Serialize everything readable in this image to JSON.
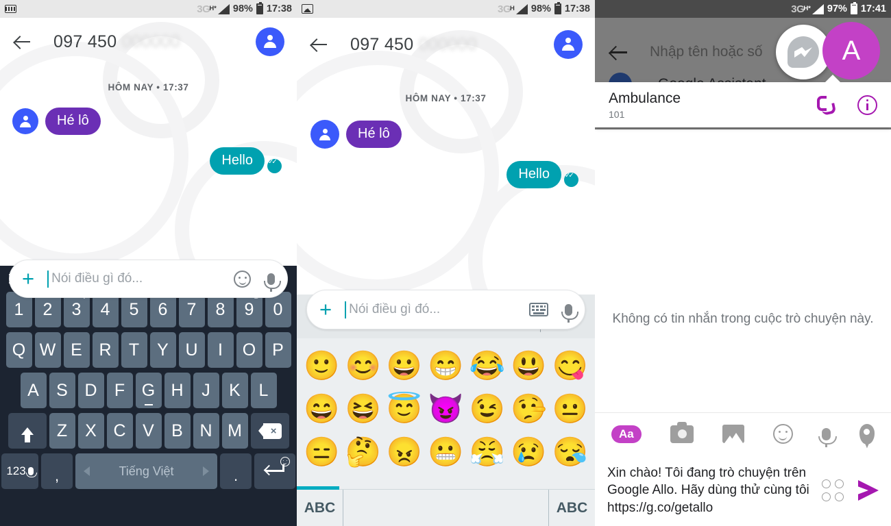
{
  "panels": {
    "left": {
      "status": {
        "icon": "keyboard-icon",
        "network": "3G",
        "network_sub": "H*",
        "battery": "98%",
        "time": "17:38"
      },
      "header": {
        "title": "097 450",
        "title_blurred": "000000",
        "back": "back-arrow",
        "avatar": "contact-avatar"
      },
      "chat": {
        "daystamp": "HÔM NAY • 17:37",
        "messages": [
          {
            "text": "Hé lô",
            "side": "in"
          },
          {
            "text": "Hello",
            "side": "out",
            "status": "delivered"
          }
        ]
      },
      "composer": {
        "placeholder": "Nói điều gì đó...",
        "value": "",
        "plus": "+",
        "emoji": "emoji-icon",
        "mic": "mic-icon"
      },
      "keyboard": {
        "menu": "hamburger-icon",
        "emoji_toggle": "emoji-icon",
        "row_numbers": [
          {
            "key": "1",
            "diacritic": "´"
          },
          {
            "key": "2",
            "diacritic": "`"
          },
          {
            "key": "3",
            "diacritic": "?"
          },
          {
            "key": "4",
            "diacritic": "~"
          },
          {
            "key": "5",
            "diacritic": "·"
          },
          {
            "key": "6",
            "diacritic": "^"
          },
          {
            "key": "7",
            "diacritic": "ʼ"
          },
          {
            "key": "8",
            "diacritic": "˘"
          },
          {
            "key": "9",
            "diacritic": "Đ"
          },
          {
            "key": "0",
            "diacritic": ""
          }
        ],
        "row_top": [
          "Q",
          "W",
          "E",
          "R",
          "T",
          "Y",
          "U",
          "I",
          "O",
          "P"
        ],
        "row_home": [
          "A",
          "S",
          "D",
          "F",
          "G",
          "H",
          "J",
          "K",
          "L"
        ],
        "row_bottom": [
          "Z",
          "X",
          "C",
          "V",
          "B",
          "N",
          "M"
        ],
        "shift": "shift-key",
        "backspace": "backspace-key",
        "num_switch": "123",
        "comma": ",",
        "space_label": "Tiếng Việt",
        "period": ".",
        "enter": "enter-key"
      }
    },
    "middle": {
      "status": {
        "icon": "image-icon",
        "network": "3G",
        "network_sub": "H",
        "battery": "98%",
        "time": "17:38"
      },
      "header": {
        "title": "097 450",
        "title_blurred": "000000"
      },
      "chat": {
        "daystamp": "HÔM NAY • 17:37",
        "messages": [
          {
            "text": "Hé lô",
            "side": "in"
          },
          {
            "text": "Hello",
            "side": "out",
            "status": "delivered"
          }
        ]
      },
      "composer": {
        "placeholder": "Nói điều gì đó...",
        "value": "",
        "plus": "+",
        "keyboard": "keyboard-icon",
        "mic": "mic-icon"
      },
      "emoji_picker": {
        "tabs": [
          {
            "name": "recent-tab",
            "icon": "clock-icon",
            "active": false
          },
          {
            "name": "smileys-tab",
            "icon": "smiley-icon",
            "active": true
          },
          {
            "name": "objects-tab",
            "icon": "crown-icon",
            "active": false
          },
          {
            "name": "nature-tab",
            "icon": "flower-icon",
            "active": false
          },
          {
            "name": "travel-tab",
            "icon": "car-icon",
            "active": false
          },
          {
            "name": "symbols-tab",
            "icon": "triangle-icon",
            "active": false
          }
        ],
        "delete": "delete-icon",
        "rows": [
          [
            "🙂",
            "😊",
            "😀",
            "😁",
            "😂",
            "😃",
            "😋"
          ],
          [
            "😄",
            "😆",
            "😇",
            "😈",
            "😉",
            "🤥",
            "😐"
          ],
          [
            "😑",
            "🤔",
            "😠",
            "😬",
            "😤",
            "😢",
            "😪"
          ]
        ],
        "footer": {
          "left_label": "ABC",
          "right_label": "ABC"
        }
      }
    },
    "right": {
      "status": {
        "network": "3G",
        "network_sub": "H*",
        "battery": "97%",
        "time": "17:41"
      },
      "search": {
        "placeholder": "Nhập tên hoặc số",
        "back": "back-arrow"
      },
      "assistant_row": {
        "label": "Google Assistant"
      },
      "fab_messenger": "messenger-icon",
      "fab_avatar": "A",
      "contact_card": {
        "name": "Ambulance",
        "number": "101",
        "call": "phone-icon",
        "info": "info-icon"
      },
      "empty_state": "Không có tin nhắn trong cuộc trò chuyện này.",
      "toolbar": [
        {
          "name": "text-style-button",
          "label": "Aa"
        },
        {
          "name": "camera-button",
          "label": ""
        },
        {
          "name": "gallery-button",
          "label": ""
        },
        {
          "name": "sticker-button",
          "label": ""
        },
        {
          "name": "voice-button",
          "label": ""
        },
        {
          "name": "location-button",
          "label": ""
        }
      ],
      "message": {
        "text": "Xin chào! Tôi đang trò chuyện trên Google Allo. Hãy dùng thử cùng tôi https://g.co/getallo",
        "like": "emoji-grid-icon",
        "send": "send-icon"
      }
    }
  },
  "colors": {
    "teal": "#00a1b0",
    "purple_bubble": "#6b2fb5",
    "blue_avatar": "#3b5afb",
    "magenta": "#c341c6",
    "magenta_dark": "#a518b0",
    "keyboard_bg": "#1c2431",
    "key_bg": "#5c6e7f"
  }
}
